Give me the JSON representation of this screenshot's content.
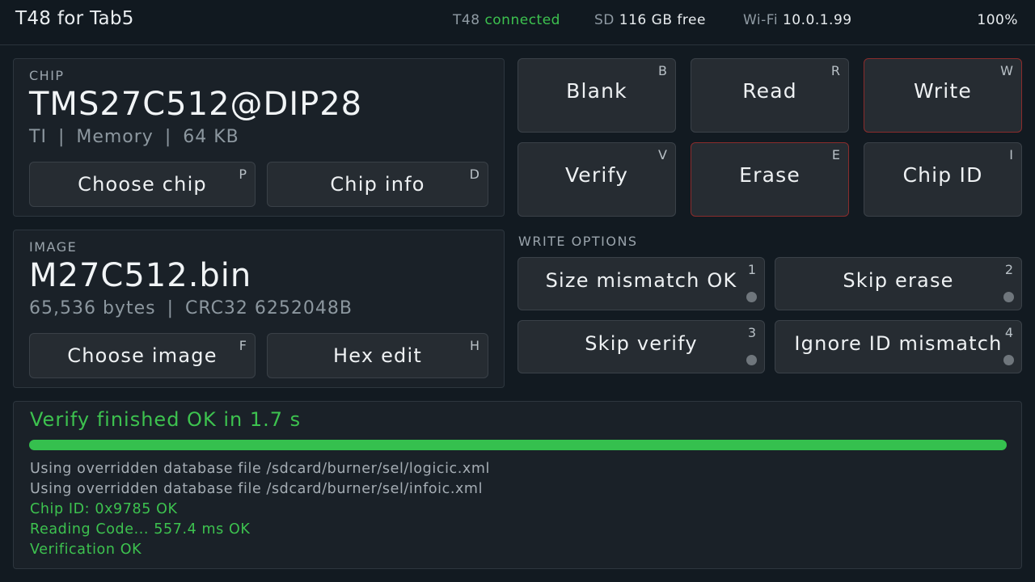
{
  "topbar": {
    "app_title": "T48 for Tab5",
    "programmer": {
      "label": "T48",
      "value": "connected"
    },
    "sd": {
      "label": "SD",
      "value": "116 GB free"
    },
    "wifi": {
      "label": "Wi-Fi",
      "value": "10.0.1.99"
    },
    "battery": "100%"
  },
  "chip": {
    "section_label": "CHIP",
    "name": "TMS27C512@DIP28",
    "manufacturer": "TI",
    "type": "Memory",
    "size": "64 KB",
    "separator": "|",
    "choose_button": {
      "label": "Choose chip",
      "key": "P"
    },
    "info_button": {
      "label": "Chip info",
      "key": "D"
    }
  },
  "image": {
    "section_label": "IMAGE",
    "filename": "M27C512.bin",
    "bytes": "65,536 bytes",
    "crc": "CRC32 6252048B",
    "separator": "|",
    "choose_button": {
      "label": "Choose image",
      "key": "F"
    },
    "hex_button": {
      "label": "Hex edit",
      "key": "H"
    }
  },
  "actions": [
    {
      "label": "Blank",
      "key": "B",
      "danger": false
    },
    {
      "label": "Read",
      "key": "R",
      "danger": false
    },
    {
      "label": "Write",
      "key": "W",
      "danger": true
    },
    {
      "label": "Verify",
      "key": "V",
      "danger": false
    },
    {
      "label": "Erase",
      "key": "E",
      "danger": true
    },
    {
      "label": "Chip ID",
      "key": "I",
      "danger": false
    }
  ],
  "write_options": {
    "section_label": "WRITE OPTIONS",
    "items": [
      {
        "label": "Size mismatch OK",
        "key": "1",
        "enabled": false
      },
      {
        "label": "Skip erase",
        "key": "2",
        "enabled": false
      },
      {
        "label": "Skip verify",
        "key": "3",
        "enabled": false
      },
      {
        "label": "Ignore ID mismatch",
        "key": "4",
        "enabled": false
      }
    ]
  },
  "status": {
    "title": "Verify finished OK in 1.7 s",
    "progress_percent": 100,
    "log": [
      {
        "text": "Using overridden database file /sdcard/burner/sel/logicic.xml",
        "ok": false
      },
      {
        "text": "Using overridden database file /sdcard/burner/sel/infoic.xml",
        "ok": false
      },
      {
        "text": "Chip ID: 0x9785  OK",
        "ok": true
      },
      {
        "text": "Reading Code...  557.4 ms  OK",
        "ok": true
      },
      {
        "text": "Verification OK",
        "ok": true
      }
    ]
  },
  "colors": {
    "accent_green": "#3dc24f",
    "danger_border": "#8a2c2c",
    "background": "#121a21"
  }
}
